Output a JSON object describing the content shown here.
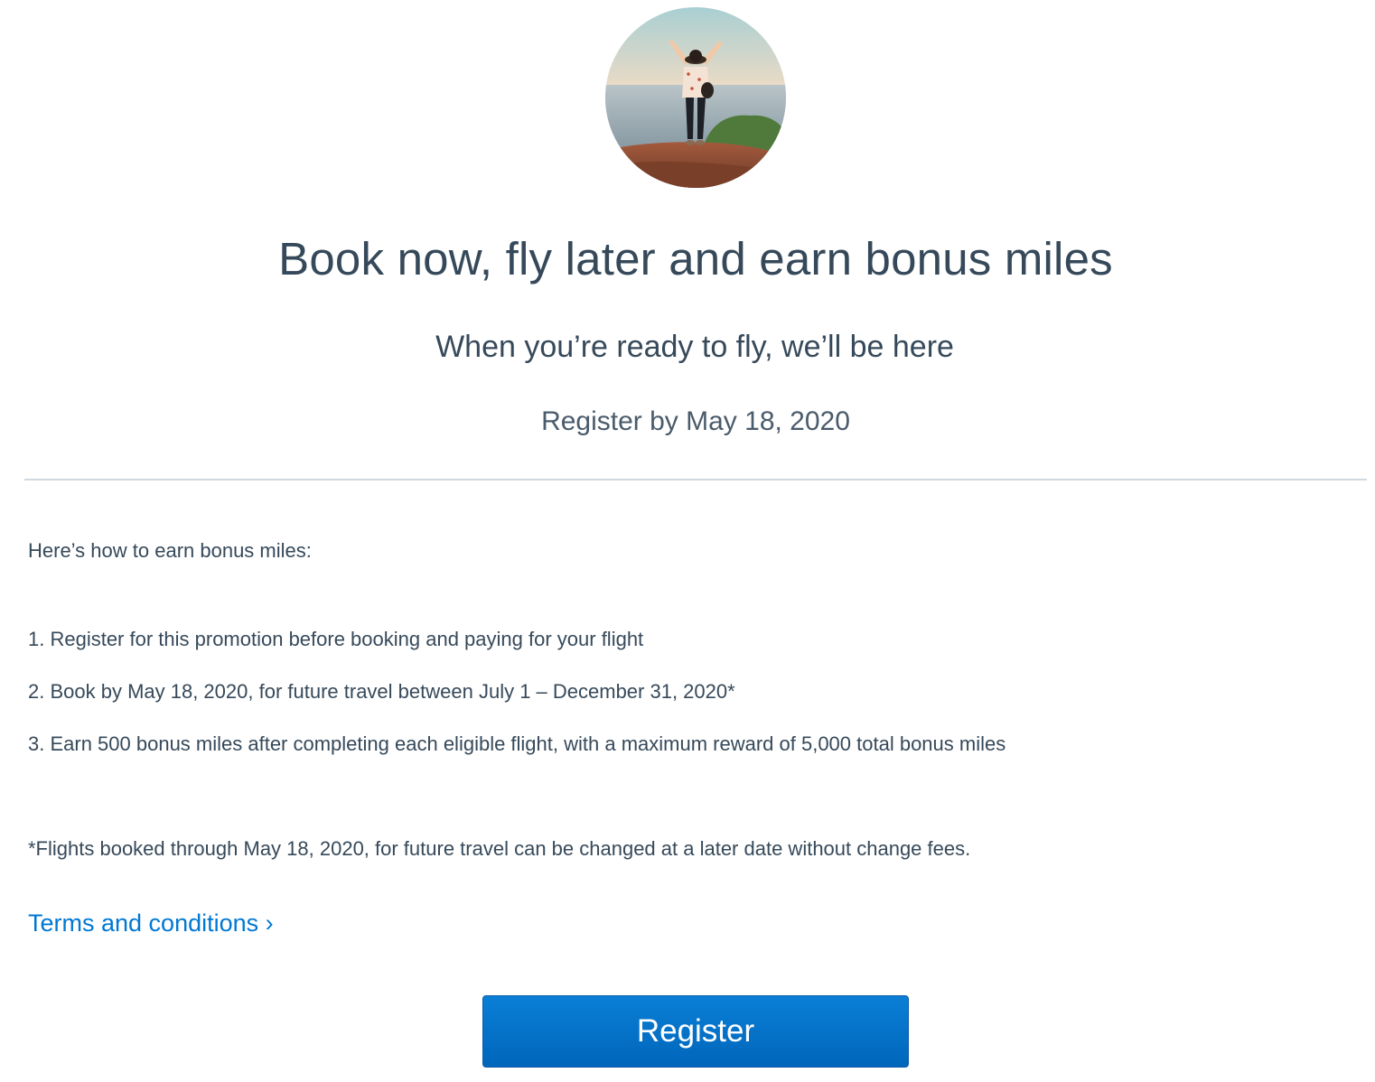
{
  "hero": {
    "image_alt": "Traveler with arms raised on a cliff overlooking the ocean"
  },
  "headline": "Book now, fly later and earn bonus miles",
  "subhead": "When you’re ready to fly, we’ll be here",
  "deadline": "Register by May 18, 2020",
  "intro": "Here’s how to earn bonus miles:",
  "steps": [
    "1. Register for this promotion before booking and paying for your flight",
    "2. Book by May 18, 2020, for future travel between July 1 – December 31, 2020*",
    "3. Earn 500 bonus miles after completing each eligible flight, with a maximum reward of 5,000 total bonus miles"
  ],
  "footnote": "*Flights booked through May 18, 2020, for future travel can be changed at a later date without change fees.",
  "terms_link": "Terms and conditions ›",
  "register_button": "Register",
  "colors": {
    "text": "#36495a",
    "link": "#0078d2",
    "button": "#0078d2",
    "divider": "#d0d9df"
  }
}
